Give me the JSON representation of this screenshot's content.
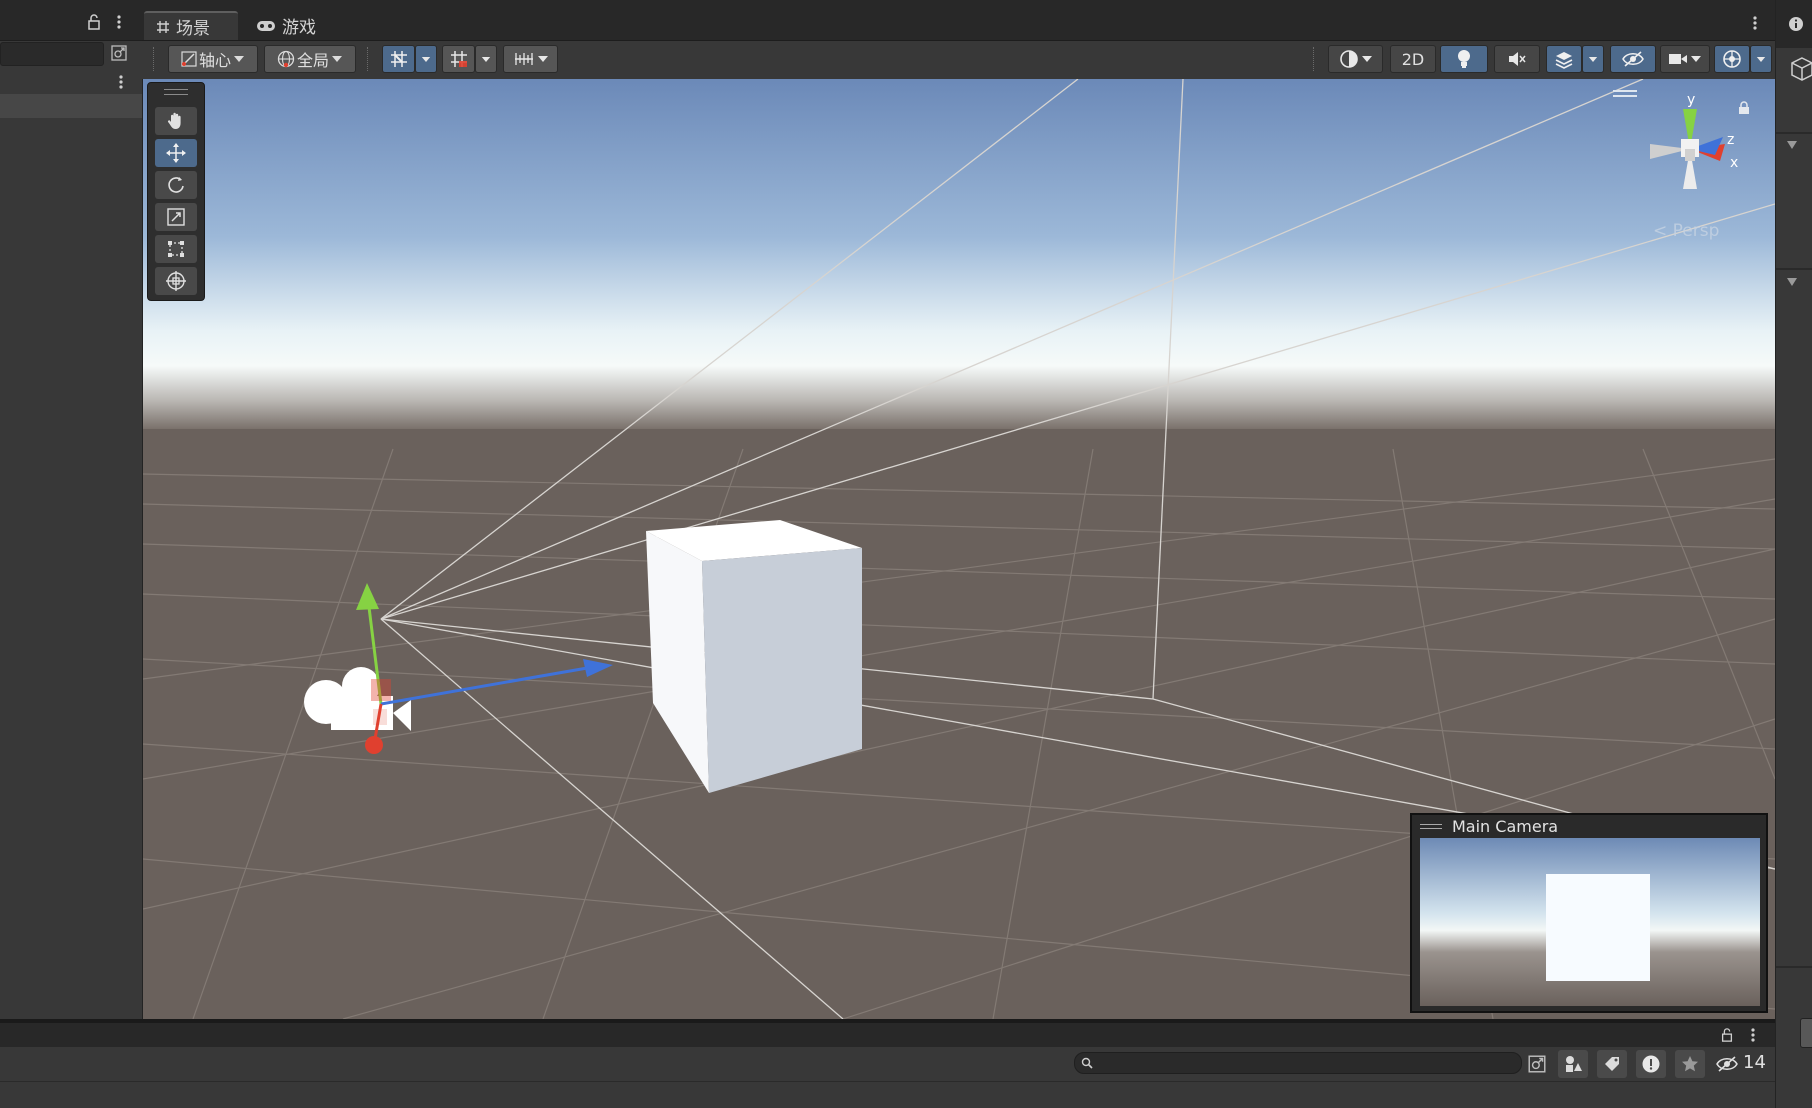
{
  "tabs": [
    {
      "label": "场景",
      "icon": "grid-hash-icon"
    },
    {
      "label": "游戏",
      "icon": "gamepad-icon"
    }
  ],
  "toolbar": {
    "pivot_label": "轴心",
    "global_label": "全局",
    "mode_2d_label": "2D",
    "persp_label": "Persp"
  },
  "gizmo": {
    "y_label": "y",
    "z_label": "z",
    "x_label": "x"
  },
  "camera_preview": {
    "title": "Main Camera"
  },
  "console": {
    "hidden_count": "14"
  },
  "colors": {
    "accent_blue": "#4d6a8c",
    "axis_x": "#e0402f",
    "axis_y": "#86d243",
    "axis_z": "#3f72d9",
    "ground": "#6a615c",
    "sky_top": "#6b89b8"
  }
}
